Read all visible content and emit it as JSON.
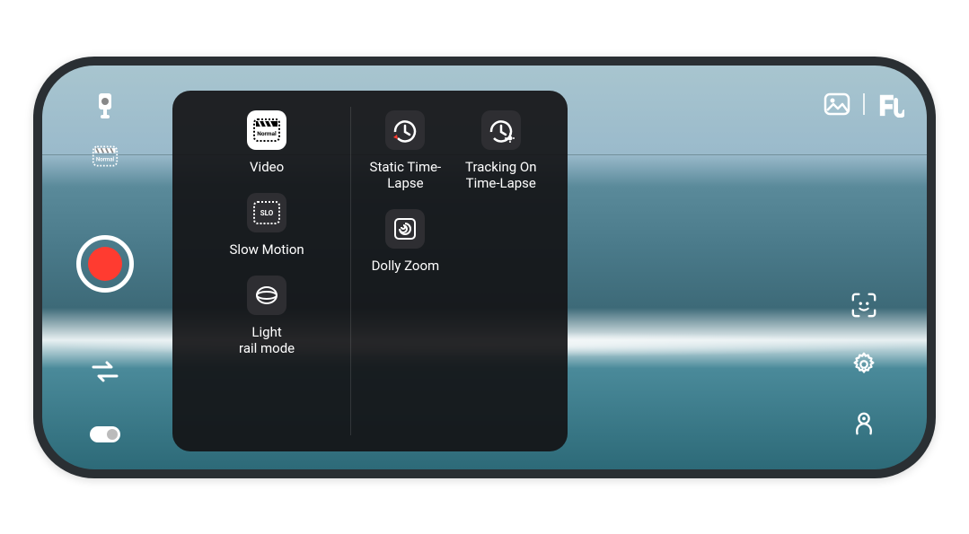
{
  "mode_menu": {
    "video": {
      "label": "Video",
      "selected": true
    },
    "slow_motion": {
      "label": "Slow Motion",
      "selected": false
    },
    "light_rail": {
      "label": "Light\nrail mode",
      "selected": false
    },
    "static_timelapse": {
      "label": "Static Time-\nLapse",
      "selected": false
    },
    "dolly_zoom": {
      "label": "Dolly Zoom",
      "selected": false
    },
    "tracking_timelapse": {
      "label": "Tracking On\nTime-Lapse",
      "selected": false
    }
  },
  "left_toolbar": {
    "gimbal_feed": "gimbal-feed",
    "mode_selector": "mode-selector",
    "record": "record",
    "swap_camera": "swap-camera",
    "effects_toggle": "effects-toggle"
  },
  "right_toolbar": {
    "gallery": "gallery",
    "brand": "brand-logo",
    "face_tracking": "face-tracking",
    "settings": "settings",
    "gesture_control": "gesture-control"
  },
  "colors": {
    "record_red": "#ff3b30",
    "panel_bg": "rgba(20,20,22,.92)",
    "icon_box": "#2e2e32",
    "icon_box_selected": "#ffffff"
  }
}
